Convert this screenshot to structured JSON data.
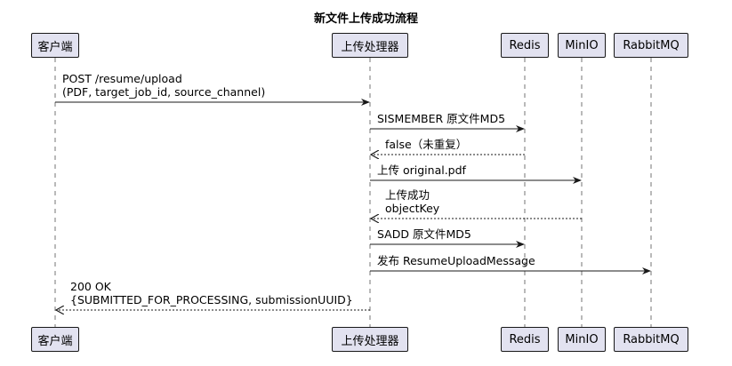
{
  "title": "新文件上传成功流程",
  "participants": [
    {
      "id": "client",
      "label": "客户端"
    },
    {
      "id": "handler",
      "label": "上传处理器"
    },
    {
      "id": "redis",
      "label": "Redis"
    },
    {
      "id": "minio",
      "label": "MinIO"
    },
    {
      "id": "rabbitmq",
      "label": "RabbitMQ"
    }
  ],
  "messages": [
    {
      "from": "client",
      "to": "handler",
      "style": "solid",
      "lines": [
        "POST /resume/upload",
        "(PDF, target_job_id, source_channel)"
      ]
    },
    {
      "from": "handler",
      "to": "redis",
      "style": "solid",
      "lines": [
        "SISMEMBER 原文件MD5"
      ]
    },
    {
      "from": "redis",
      "to": "handler",
      "style": "dashed",
      "lines": [
        "false（未重复）"
      ]
    },
    {
      "from": "handler",
      "to": "minio",
      "style": "solid",
      "lines": [
        "上传 original.pdf"
      ]
    },
    {
      "from": "minio",
      "to": "handler",
      "style": "dashed",
      "lines": [
        "上传成功",
        "objectKey"
      ]
    },
    {
      "from": "handler",
      "to": "redis",
      "style": "solid",
      "lines": [
        "SADD 原文件MD5"
      ]
    },
    {
      "from": "handler",
      "to": "rabbitmq",
      "style": "solid",
      "lines": [
        "发布 ResumeUploadMessage"
      ]
    },
    {
      "from": "handler",
      "to": "client",
      "style": "dashed",
      "lines": [
        "200 OK",
        "{SUBMITTED_FOR_PROCESSING, submissionUUID}"
      ]
    }
  ]
}
